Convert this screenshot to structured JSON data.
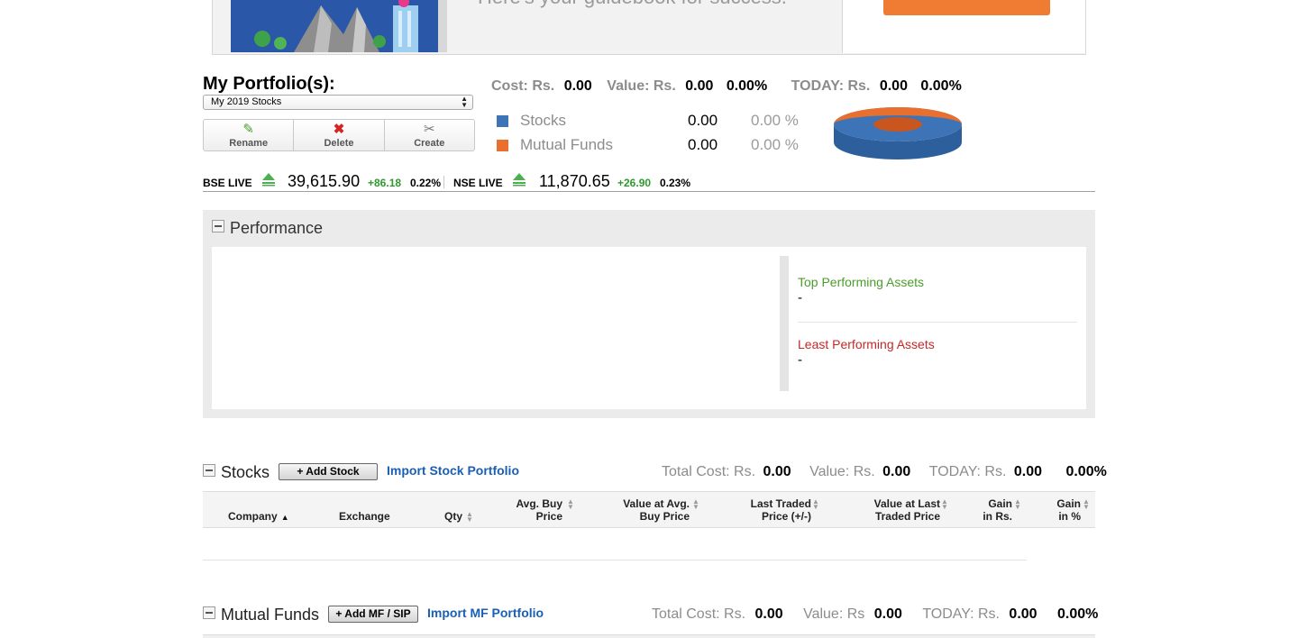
{
  "banner": {
    "tagline": "Here's your guidebook for success."
  },
  "portfolio": {
    "title": "My Portfolio(s):",
    "selected": "My 2019 Stocks",
    "buttons": {
      "rename": "Rename",
      "delete": "Delete",
      "create": "Create"
    }
  },
  "summary": {
    "cost_label": "Cost: Rs.",
    "cost_value": "0.00",
    "value_label": "Value: Rs.",
    "value_value": "0.00",
    "value_pct": "0.00%",
    "today_label": "TODAY: Rs.",
    "today_value": "0.00",
    "today_pct": "0.00%"
  },
  "allocation": [
    {
      "name": "Stocks",
      "value": "0.00",
      "pct": "0.00 %",
      "color": "#3d74b8"
    },
    {
      "name": "Mutual Funds",
      "value": "0.00",
      "pct": "0.00 %",
      "color": "#e86f2e"
    }
  ],
  "live": {
    "bse": {
      "label": "BSE LIVE",
      "value": "39,615.90",
      "change": "+86.18",
      "pct": "0.22%"
    },
    "nse": {
      "label": "NSE LIVE",
      "value": "11,870.65",
      "change": "+26.90",
      "pct": "0.23%"
    }
  },
  "performance": {
    "title": "Performance",
    "top_label": "Top Performing Assets",
    "top_value": "-",
    "least_label": "Least Performing Assets",
    "least_value": "-"
  },
  "stocks": {
    "title": "Stocks",
    "add_button": "+ Add Stock",
    "import_link": "Import Stock Portfolio",
    "total_cost_label": "Total Cost: Rs.",
    "total_cost_value": "0.00",
    "value_label": "Value: Rs.",
    "value_value": "0.00",
    "today_label": "TODAY: Rs.",
    "today_value": "0.00",
    "today_pct": "0.00%",
    "columns": {
      "company": "Company",
      "exchange": "Exchange",
      "qty": "Qty",
      "avg_buy_1": "Avg. Buy",
      "avg_buy_2": "Price",
      "value_avg_1": "Value at Avg.",
      "value_avg_2": "Buy Price",
      "ltp_1": "Last Traded",
      "ltp_2": "Price (+/-)",
      "value_ltp_1": "Value at Last",
      "value_ltp_2": "Traded Price",
      "gain_rs_1": "Gain",
      "gain_rs_2": "in Rs.",
      "gain_pct_1": "Gain",
      "gain_pct_2": "in %"
    }
  },
  "mutual_funds": {
    "title": "Mutual Funds",
    "add_button": "+ Add MF / SIP",
    "import_link": "Import MF Portfolio",
    "total_cost_label": "Total Cost: Rs.",
    "total_cost_value": "0.00",
    "value_label": "Value: Rs",
    "value_value": "0.00",
    "today_label": "TODAY: Rs.",
    "today_value": "0.00",
    "today_pct": "0.00%"
  }
}
